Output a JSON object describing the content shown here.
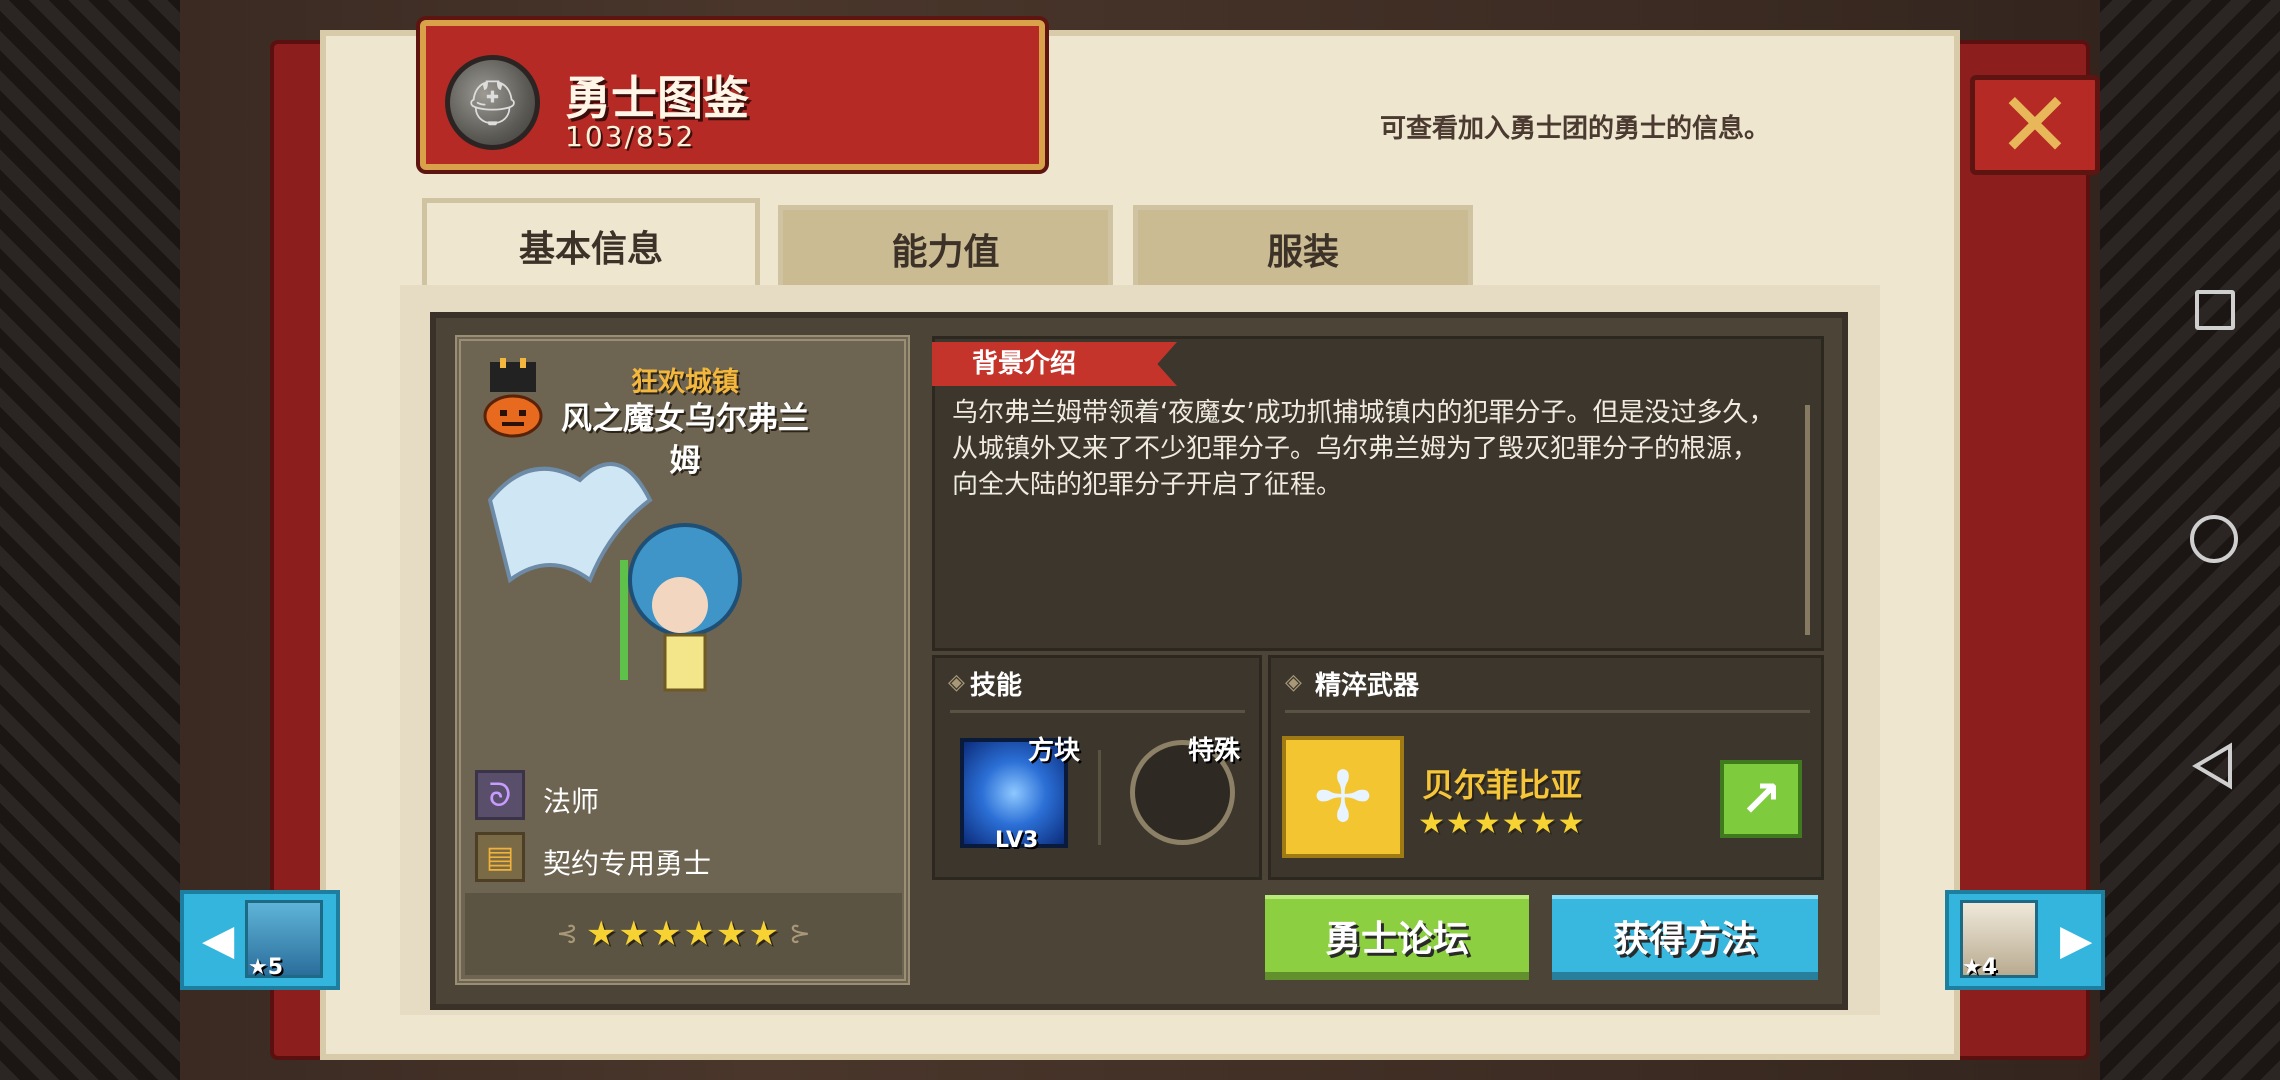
{
  "header": {
    "title": "勇士图鉴",
    "count": "103/852",
    "hint": "可查看加入勇士团的勇士的信息。"
  },
  "tabs": [
    {
      "label": "基本信息",
      "active": true
    },
    {
      "label": "能力值",
      "active": false
    },
    {
      "label": "服装",
      "active": false
    }
  ],
  "hero": {
    "region": "狂欢城镇",
    "name": "风之魔女乌尔弗兰姆",
    "class": "法师",
    "contract": "契约专用勇士",
    "stars": "★★★★★★",
    "star_count": 6
  },
  "story": {
    "header": "背景介绍",
    "text": "乌尔弗兰姆带领着‘夜魔女’成功抓捕城镇内的犯罪分子。但是没过多久，从城镇外又来了不少犯罪分子。乌尔弗兰姆为了毁灭犯罪分子的根源，向全大陆的犯罪分子开启了征程。"
  },
  "skills": {
    "title": "技能",
    "block_label": "方块",
    "block_level": "LV3",
    "special_label": "特殊"
  },
  "weapon": {
    "title": "精淬武器",
    "name": "贝尔菲比亚",
    "stars": "★★★★★★",
    "star_count": 6
  },
  "buttons": {
    "forum": "勇士论坛",
    "obtain": "获得方法"
  },
  "nav": {
    "prev_star": "★5",
    "next_star": "★4"
  },
  "colors": {
    "banner_red": "#b52a25",
    "star_gold": "#f6d232",
    "forum_green": "#8ccf40",
    "obtain_blue": "#38b7df"
  }
}
